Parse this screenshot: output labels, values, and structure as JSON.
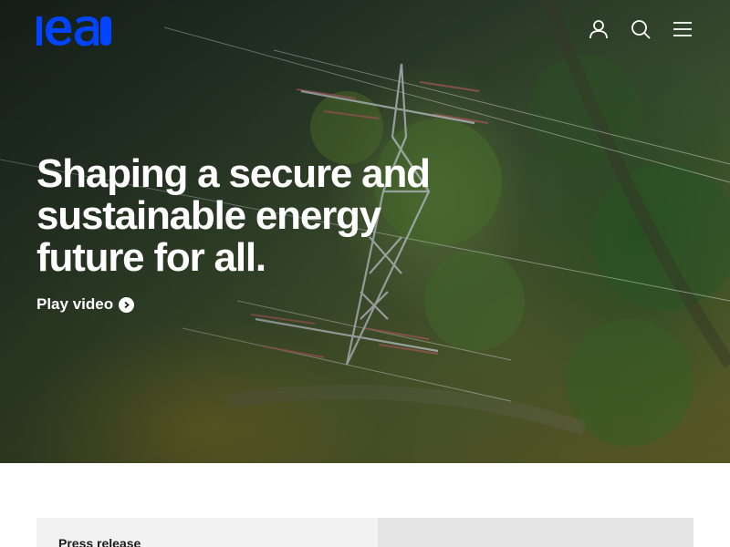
{
  "brand": {
    "logo_text": "iea",
    "logo_color": "#0044ff"
  },
  "nav": {
    "icons": [
      "user-icon",
      "search-icon",
      "menu-icon"
    ]
  },
  "hero": {
    "title": "Shaping a secure and sustainable energy future for all.",
    "play_video_label": "Play video"
  },
  "featured": {
    "label": "Press release"
  },
  "colors": {
    "brand_blue": "#0044ff",
    "hero_text": "#ffffff",
    "card_bg": "#f2f2f2",
    "card_image_bg": "#e4e4e4"
  }
}
